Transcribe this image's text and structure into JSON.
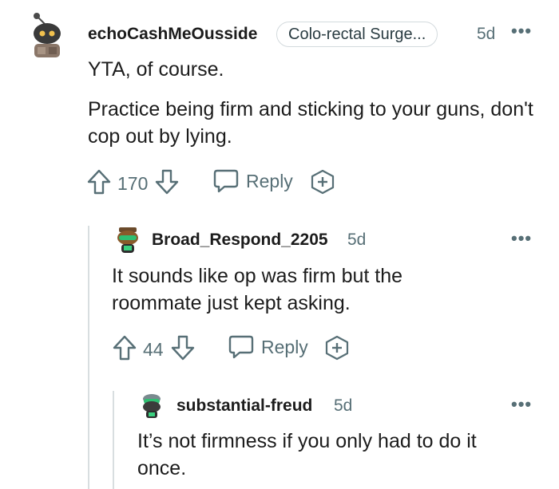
{
  "comments": [
    {
      "username": "echoCashMeOusside",
      "flair": "Colo-rectal Surge...",
      "time": "5d",
      "body": [
        "YTA, of course.",
        "Practice being firm and sticking to your guns, don't cop out by lying."
      ],
      "score": "170",
      "reply_label": "Reply",
      "avatar_icon": "snoo-robot-avatar"
    },
    {
      "username": "Broad_Respond_2205",
      "time": "5d",
      "body": [
        "It sounds like op was firm but the roommate just kept asking."
      ],
      "score": "44",
      "reply_label": "Reply",
      "avatar_icon": "snoo-green-avatar"
    },
    {
      "username": "substantial-freud",
      "time": "5d",
      "body": [
        "It’s not firmness if you only had to do it once."
      ],
      "avatar_icon": "snoo-green-avatar"
    }
  ],
  "overflow_icon": "more-dots-icon",
  "colors": {
    "text": "#1c1c1c",
    "meta": "#576f76",
    "thread_line": "#d8dee0"
  }
}
